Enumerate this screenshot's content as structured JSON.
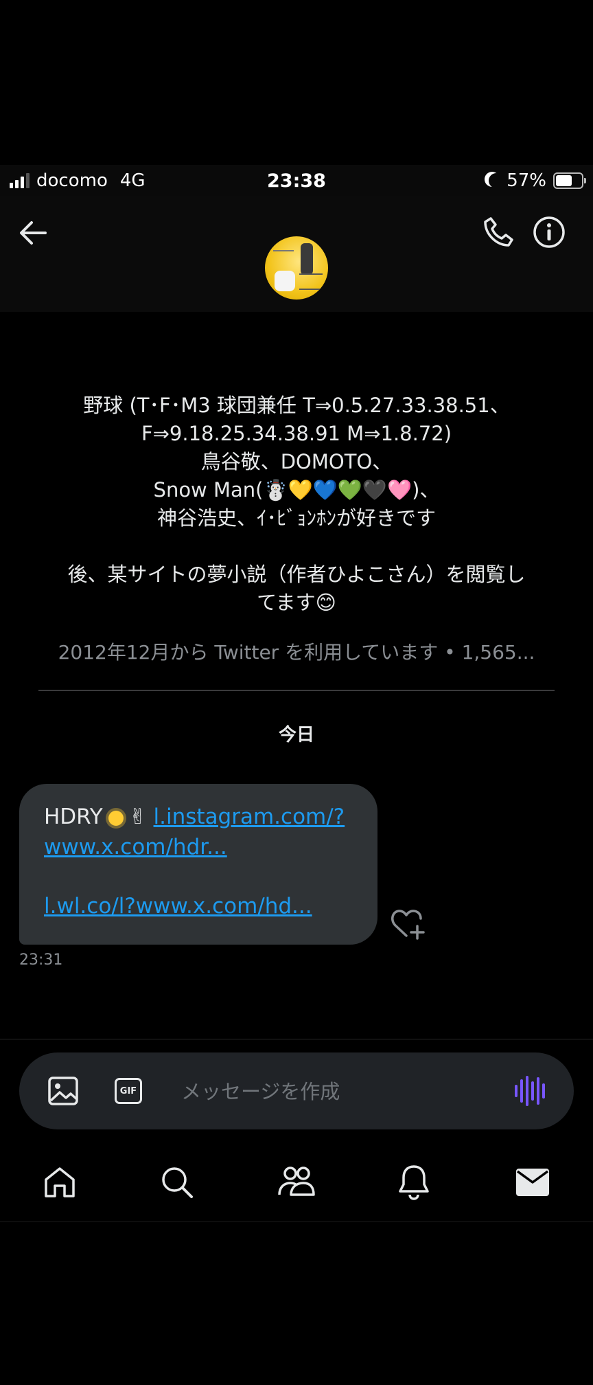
{
  "status_bar": {
    "carrier": "docomo",
    "network": "4G",
    "time": "23:38",
    "battery_percent": "57%",
    "battery_level": 0.57
  },
  "header": {
    "back_icon": "arrow-left-icon",
    "call_icon": "phone-icon",
    "info_icon": "info-icon"
  },
  "bio": {
    "line1": "野球 (T･F･M3 球団兼任 T⇒0.5.27.33.38.51、",
    "line2": "F⇒9.18.25.34.38.91 M⇒1.8.72)",
    "line3": "鳥谷敬、DOMOTO、",
    "line4": "Snow Man(☃️💛💙💚🖤🩷)、",
    "line5": "神谷浩史、ｲ･ﾋﾞｮﾝﾎﾝが好きです",
    "line6": "後、某サイトの夢小説（作者ひよこさん）を閲覧し",
    "line7": "てます😊",
    "joined": "2012年12月から Twitter を利用しています • 1,565..."
  },
  "divider_label": "今日",
  "message": {
    "prefix": "HDRY",
    "suffix": "✌",
    "link1_part1": "l.instagram.com/?",
    "link1_part2": "www.x.com/hdr...",
    "link2": "l.wl.co/l?www.x.com/hd...",
    "time": "23:31"
  },
  "composer": {
    "placeholder": "メッセージを作成",
    "image_icon": "image-icon",
    "gif_label": "GIF",
    "voice_icon": "voice-waveform-icon"
  },
  "tabbar": {
    "items": [
      "home-icon",
      "search-icon",
      "communities-icon",
      "notifications-icon",
      "messages-icon"
    ]
  },
  "colors": {
    "background": "#000000",
    "bubble": "#2f3336",
    "link": "#1d9bf0",
    "accent_voice": "#7856ff",
    "muted_text": "#8b8f94"
  }
}
